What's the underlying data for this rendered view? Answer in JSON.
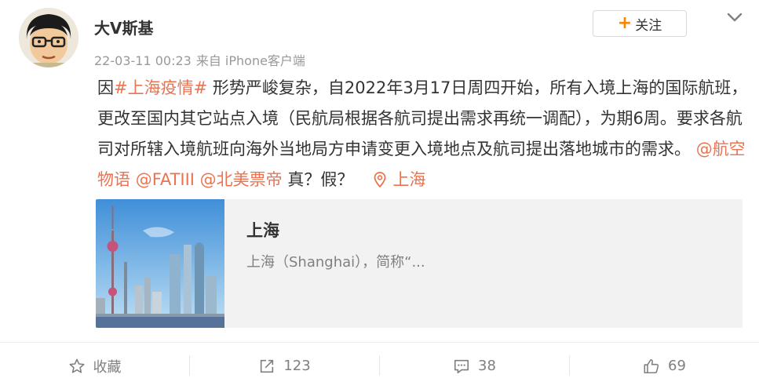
{
  "author": {
    "name": "大V斯基",
    "avatar_label": "avatar"
  },
  "meta": {
    "time": "22-03-11 00:23",
    "source": "来自 iPhone客户端"
  },
  "follow": {
    "label": "关注"
  },
  "post": {
    "prefix": "因",
    "topic": "#上海疫情#",
    "body": " 形势严峻复杂，自2022年3月17日周四开始，所有入境上海的国际航班，更改至国内其它站点入境（民航局根据各航司提出需求再统一调配），为期6周。要求各航司对所辖入境航班向海外当地局方申请变更入境地点及航司提出落地城市的需求。",
    "mentions": [
      "@航空物语",
      "@FATIII",
      "@北美票帝"
    ],
    "suffix": " 真？假？",
    "location": "上海"
  },
  "card": {
    "title": "上海",
    "desc": "上海（Shanghai），简称“..."
  },
  "actions": {
    "favorite": "收藏",
    "repost": "123",
    "comment": "38",
    "like": "69"
  },
  "colors": {
    "accent": "#eb7350",
    "follow_plus": "#ff8200"
  }
}
